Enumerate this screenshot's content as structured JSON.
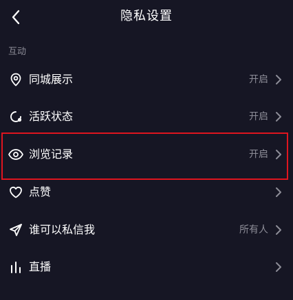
{
  "header": {
    "title": "隐私设置",
    "back_icon": "chevron-left-icon"
  },
  "section": {
    "label": "互动"
  },
  "items": [
    {
      "label": "同城展示",
      "value": "开启",
      "icon": "location-pin-icon"
    },
    {
      "label": "活跃状态",
      "value": "开启",
      "icon": "activity-status-icon"
    },
    {
      "label": "浏览记录",
      "value": "开启",
      "icon": "eye-icon"
    },
    {
      "label": "点赞",
      "value": "",
      "icon": "heart-icon"
    },
    {
      "label": "谁可以私信我",
      "value": "所有人",
      "icon": "send-icon"
    },
    {
      "label": "直播",
      "value": "",
      "icon": "bar-chart-icon"
    }
  ],
  "colors": {
    "background": "#161624",
    "text": "#ffffff",
    "secondary_text": "#8d8d98",
    "highlight": "#e0151f"
  }
}
